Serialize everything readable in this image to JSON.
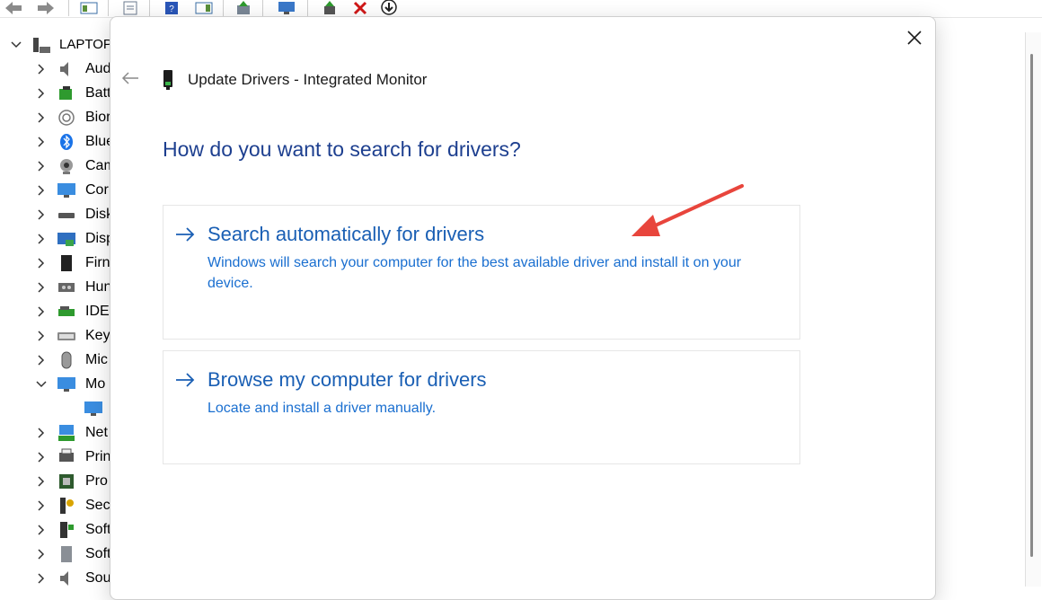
{
  "tree": {
    "root_label": "LAPTOP",
    "items": [
      {
        "label": "Aud",
        "icon": "speaker-icon",
        "expanded": false
      },
      {
        "label": "Batt",
        "icon": "battery-icon",
        "expanded": false
      },
      {
        "label": "Bior",
        "icon": "fingerprint-icon",
        "expanded": false
      },
      {
        "label": "Blue",
        "icon": "bluetooth-icon",
        "expanded": false
      },
      {
        "label": "Cam",
        "icon": "camera-icon",
        "expanded": false
      },
      {
        "label": "Cor",
        "icon": "computer-icon",
        "expanded": false
      },
      {
        "label": "Disk",
        "icon": "disk-drive-icon",
        "expanded": false
      },
      {
        "label": "Disp",
        "icon": "display-adapter-icon",
        "expanded": false
      },
      {
        "label": "Firn",
        "icon": "firmware-icon",
        "expanded": false
      },
      {
        "label": "Hun",
        "icon": "hid-icon",
        "expanded": false
      },
      {
        "label": "IDE",
        "icon": "ide-controller-icon",
        "expanded": false
      },
      {
        "label": "Key",
        "icon": "keyboard-icon",
        "expanded": false
      },
      {
        "label": "Mic",
        "icon": "mouse-icon",
        "expanded": false
      },
      {
        "label": "Mo",
        "icon": "monitor-icon",
        "expanded": true
      },
      {
        "label": "",
        "icon": "monitor-child-icon",
        "child": true
      },
      {
        "label": "Net",
        "icon": "network-adapter-icon",
        "expanded": false
      },
      {
        "label": "Prin",
        "icon": "print-queue-icon",
        "expanded": false
      },
      {
        "label": "Pro",
        "icon": "processor-icon",
        "expanded": false
      },
      {
        "label": "Sec",
        "icon": "security-device-icon",
        "expanded": false
      },
      {
        "label": "Soft",
        "icon": "software-component-icon",
        "expanded": false
      },
      {
        "label": "Soft",
        "icon": "software-device-icon",
        "expanded": false
      },
      {
        "label": "Sou",
        "icon": "sound-icon",
        "expanded": false
      }
    ]
  },
  "dialog": {
    "title": "Update Drivers - Integrated Monitor",
    "question": "How do you want to search for drivers?",
    "options": [
      {
        "title": "Search automatically for drivers",
        "description": "Windows will search your computer for the best available driver and install it on your device."
      },
      {
        "title": "Browse my computer for drivers",
        "description": "Locate and install a driver manually."
      }
    ]
  },
  "colors": {
    "question": "#1d3f8f",
    "option_title": "#1a5fb4",
    "option_desc": "#1a6fd0",
    "annotation_arrow": "#e8453c"
  }
}
